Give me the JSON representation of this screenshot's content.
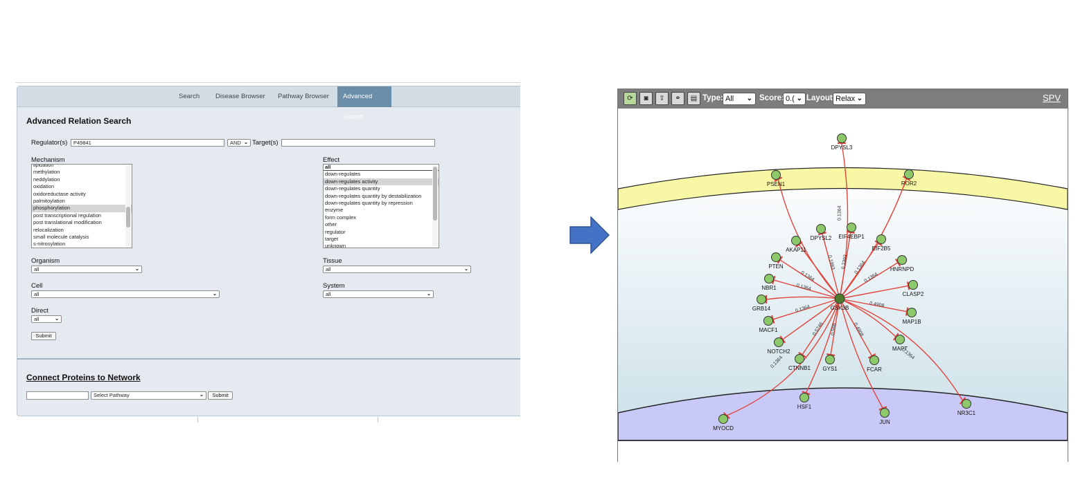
{
  "search": {
    "nav_tabs": [
      "Search",
      "Disease Browser",
      "Pathway Browser",
      "Advanced Search"
    ],
    "title": "Advanced Relation Search",
    "regulator_label": "Regulator(s)",
    "regulator_value": "P49841",
    "operator": "AND",
    "target_label": "Target(s)",
    "target_value": "",
    "mechanism_label": "Mechanism",
    "mechanism_options": [
      "lipidation",
      "methylation",
      "neddylation",
      "oxidation",
      "oxidoreductase activity",
      "palmitoylation",
      "phosphorylation",
      "post transcriptional regulation",
      "post translational modification",
      "relocalization",
      "small molecule catalysis",
      "s-nitrosylation"
    ],
    "mechanism_selected": "phosphorylation",
    "effect_label": "Effect",
    "effect_options": [
      "all",
      "down-regulates",
      "down-regulates activity",
      "down-regulates quantity",
      "down-regulates quantity by destabilization",
      "down-regulates quantity by repression",
      "enzyme",
      "form complex",
      "other",
      "regulator",
      "target",
      "unknown"
    ],
    "effect_selected": "down-regulates activity",
    "organism_label": "Organism",
    "organism_value": "all",
    "tissue_label": "Tissue",
    "tissue_value": "all",
    "cell_label": "Cell",
    "cell_value": "all",
    "system_label": "System",
    "system_value": "all",
    "direct_label": "Direct",
    "direct_value": "all",
    "submit_label": "Submit",
    "connect_title": "Connect Proteins to Network",
    "pathway_select": "Select Pathway",
    "connect_submit": "Submit",
    "colors": {
      "active_tab": "#6d8ea8",
      "panel_bg": "#e4eaef"
    }
  },
  "network": {
    "toolbar": {
      "icons": [
        "refresh-icon",
        "camera-icon",
        "export-icon",
        "network-icon",
        "clipboard-icon"
      ],
      "type_label": "Type:",
      "type_value": "All",
      "score_label": "Score:",
      "score_value": "0.(",
      "layout_label": "Layout:",
      "layout_value": "Relax",
      "spv_label": "SPV"
    },
    "center_node": "GSK3B",
    "nodes": [
      "DPYSL3",
      "PSEN1",
      "ROR2",
      "AKAP11",
      "DPYSL2",
      "EIF4EBP1",
      "EIF2B5",
      "PTEN",
      "HNRNPD",
      "NBR1",
      "CLASP2",
      "GRB14",
      "MAP1B",
      "MACF1",
      "MAPT",
      "NOTCH2",
      "CTNNB1",
      "GYS1",
      "FCAR",
      "HSF1",
      "JUN",
      "NR3C1",
      "MYOCD"
    ],
    "edge_labels": [
      "0.1364",
      "0.1983",
      "0.2393",
      "0.1364",
      "0.1364",
      "0.4908",
      "0.1364",
      "0.1364",
      "0.1364",
      "0.1364",
      "0.4908",
      "0.566",
      "0.5746",
      "0.1364"
    ],
    "colors": {
      "node_fill": "#8dc96a",
      "center_fill": "#4d7a2c",
      "edge": "#e0443c",
      "membrane": "#f7f7a6",
      "nucleus": "#c9c9f7"
    }
  }
}
